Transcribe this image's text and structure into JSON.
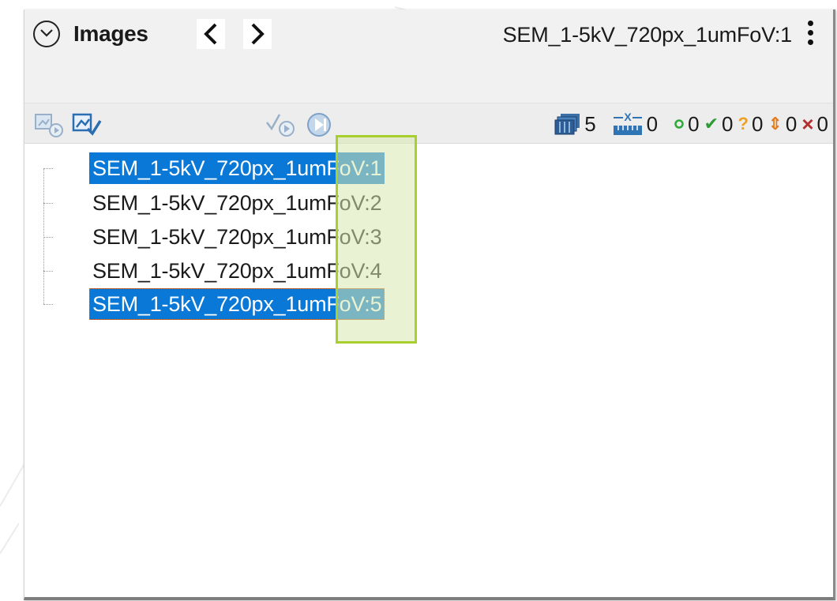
{
  "panel": {
    "title": "Images",
    "current_image": "SEM_1-5kV_720px_1umFoV:1"
  },
  "nav": {
    "prev": "<",
    "next": ">"
  },
  "counts": [
    {
      "icon": "image-stack-icon",
      "value": "5"
    },
    {
      "icon": "scale-bar-icon",
      "value": "0"
    },
    {
      "icon": "circle-status-icon",
      "glyph": "∘",
      "color": "#2eaa3a",
      "value": "0"
    },
    {
      "icon": "check-icon",
      "glyph": "✔",
      "color": "#2e9a36",
      "value": "0"
    },
    {
      "icon": "question-icon",
      "glyph": "?",
      "color": "#f0a020",
      "value": "0"
    },
    {
      "icon": "up-down-arrow-icon",
      "glyph": "⇕",
      "color": "#e27a1c",
      "value": "0"
    },
    {
      "icon": "cross-icon",
      "glyph": "×",
      "color": "#b23030",
      "value": "0"
    }
  ],
  "images": [
    {
      "label": "SEM_1-5kV_720px_1umFoV:1",
      "selected": true
    },
    {
      "label": "SEM_1-5kV_720px_1umFoV:2",
      "selected": false
    },
    {
      "label": "SEM_1-5kV_720px_1umFoV:3",
      "selected": false
    },
    {
      "label": "SEM_1-5kV_720px_1umFoV:4",
      "selected": false
    },
    {
      "label": "SEM_1-5kV_720px_1umFoV:5",
      "selected": true
    }
  ],
  "colors": {
    "selection": "#0a78d7",
    "highlight_border": "#a9cf2f",
    "highlight_fill": "#d7e8af"
  }
}
